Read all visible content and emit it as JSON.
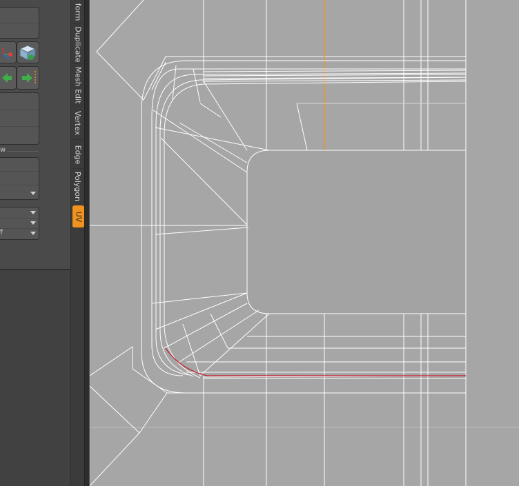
{
  "tabs": [
    {
      "label": "form",
      "active": false
    },
    {
      "label": "Duplicate",
      "active": false
    },
    {
      "label": "Mesh Edit",
      "active": false
    },
    {
      "label": "Vertex",
      "active": false
    },
    {
      "label": "Edge",
      "active": false
    },
    {
      "label": "Polygon",
      "active": false
    },
    {
      "label": "UV",
      "active": true
    }
  ],
  "panel": {
    "section_label": "w",
    "dropdown_3_value": "ff"
  },
  "colors": {
    "accent": "#f0931e",
    "selected_edge": "#c8192b",
    "wireframe": "#ffffff",
    "viewport_bg": "#a6a6a6"
  }
}
